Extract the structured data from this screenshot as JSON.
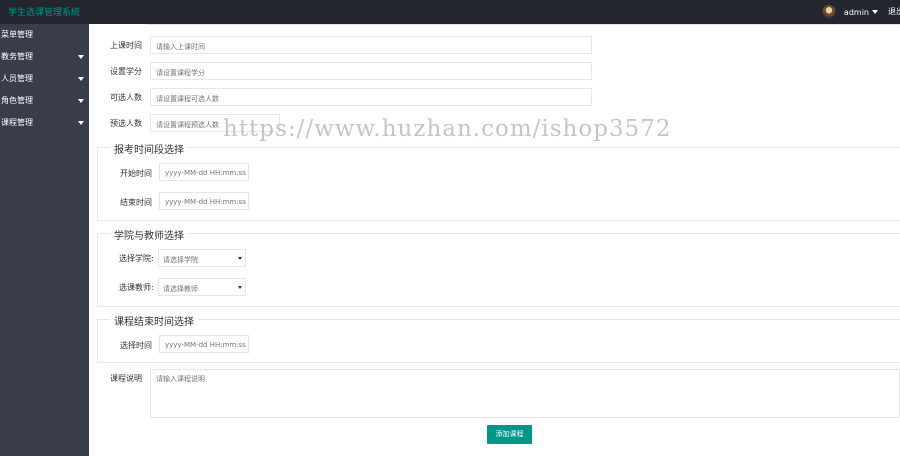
{
  "app": {
    "title": "学生选课管理系统"
  },
  "header": {
    "username": "admin",
    "logout_label": "退出"
  },
  "sidebar": {
    "items": [
      {
        "label": "菜单管理",
        "has_arrow": false
      },
      {
        "label": "教务管理",
        "has_arrow": true
      },
      {
        "label": "人员管理",
        "has_arrow": true
      },
      {
        "label": "角色管理",
        "has_arrow": true
      },
      {
        "label": "课程管理",
        "has_arrow": true
      }
    ]
  },
  "form": {
    "course_time": {
      "label": "上课时间",
      "placeholder": "请输入上课时间"
    },
    "credit": {
      "label": "设置学分",
      "placeholder": "请设置课程学分"
    },
    "capacity": {
      "label": "可选人数",
      "placeholder": "请设置课程可选人数"
    },
    "reserved": {
      "label": "预选人数",
      "placeholder": "请设置课程预选人数"
    },
    "enroll_period": {
      "legend": "报考时间段选择",
      "start": {
        "label": "开始时间",
        "placeholder": "yyyy-MM-dd HH:mm:ss"
      },
      "end": {
        "label": "结束时间",
        "placeholder": "yyyy-MM-dd HH:mm:ss"
      }
    },
    "college_teacher": {
      "legend": "学院与教师选择",
      "college": {
        "label": "选择学院:",
        "placeholder": "请选择学院"
      },
      "teacher": {
        "label": "选课教师:",
        "placeholder": "请选择教师"
      }
    },
    "course_end": {
      "legend": "课程结束时间选择",
      "time": {
        "label": "选择时间",
        "placeholder": "yyyy-MM-dd HH:mm:ss"
      }
    },
    "description": {
      "label": "课程说明",
      "placeholder": "请输入课程说明"
    },
    "submit_label": "添加课程"
  },
  "watermark": "https://www.huzhan.com/ishop3572",
  "colors": {
    "accent": "#009688",
    "topbar": "#23262e",
    "sidebar": "#393d49"
  }
}
